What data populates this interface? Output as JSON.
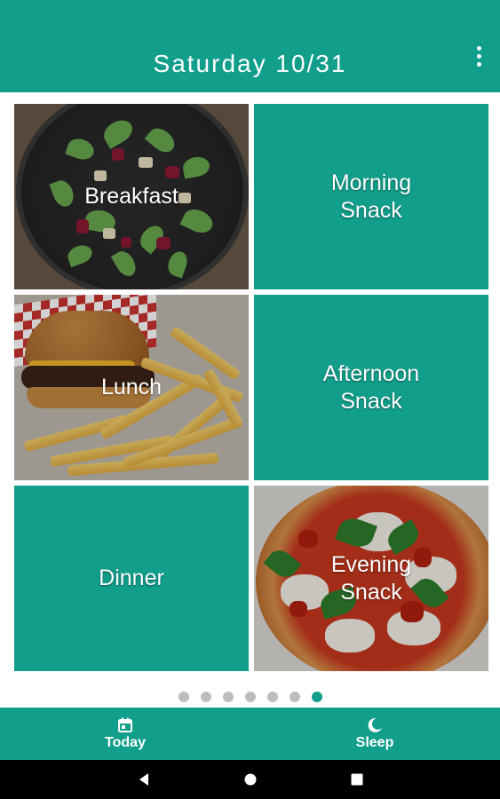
{
  "app_bar": {
    "title": "Saturday 10/31",
    "overflow_icon": "more-vert-icon"
  },
  "tiles": [
    {
      "label": "Breakfast",
      "style": "photo"
    },
    {
      "label": "Morning\nSnack",
      "style": "solid"
    },
    {
      "label": "Lunch",
      "style": "photo"
    },
    {
      "label": "Afternoon\nSnack",
      "style": "solid"
    },
    {
      "label": "Dinner",
      "style": "solid"
    },
    {
      "label": "Evening\nSnack",
      "style": "photo"
    }
  ],
  "pager": {
    "total": 7,
    "active_index": 6
  },
  "bottom_nav": {
    "today_label": "Today",
    "today_icon": "calendar-icon",
    "sleep_label": "Sleep",
    "sleep_icon": "moon-icon"
  },
  "system_nav": {
    "back_icon": "back-triangle-icon",
    "home_icon": "home-circle-icon",
    "recents_icon": "recents-square-icon"
  },
  "colors": {
    "accent": "#119e8b",
    "dot_inactive": "#bdbdbd"
  }
}
